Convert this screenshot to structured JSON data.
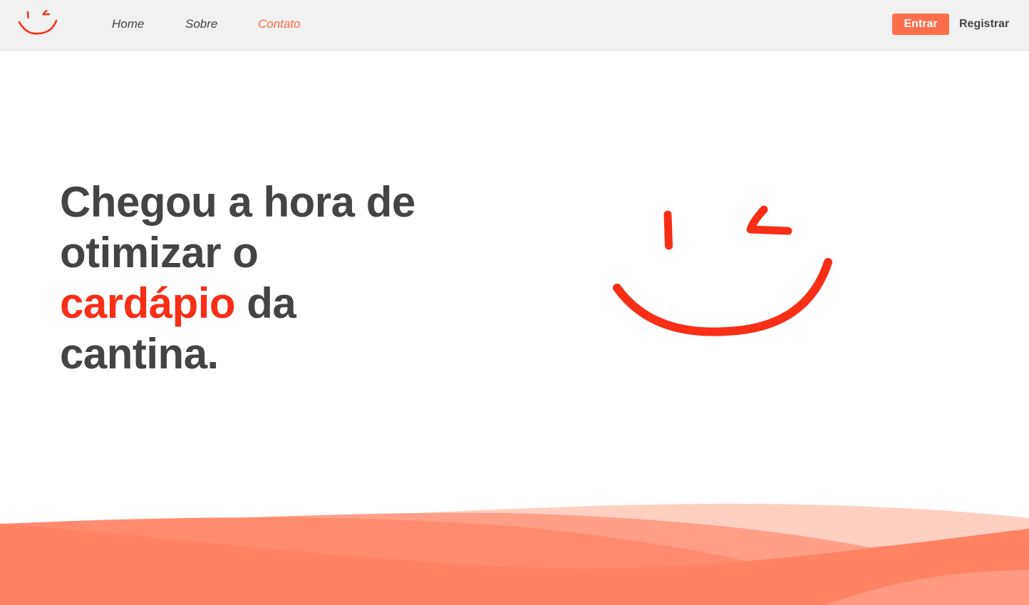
{
  "nav": {
    "logo_icon": "smiley-wink-icon",
    "links": [
      {
        "label": "Home"
      },
      {
        "label": "Sobre"
      },
      {
        "label": "Contato"
      }
    ],
    "active_link": "Contato",
    "login_label": "Entrar",
    "register_label": "Registrar"
  },
  "hero": {
    "line1": "Chegou a hora de",
    "line2": "otimizar o",
    "highlight": "cardápio",
    "line3_rest": "da",
    "line4": "cantina.",
    "illustration_icon": "smiley-wink-icon"
  },
  "colors": {
    "accent": "#f92e16",
    "button": "#ff6e4c",
    "text": "#444444",
    "navbar_bg": "#f1f1f1",
    "wave_light": "#ffd0c2",
    "wave_mid": "#ff9f86",
    "wave_dark": "#ff8262"
  }
}
